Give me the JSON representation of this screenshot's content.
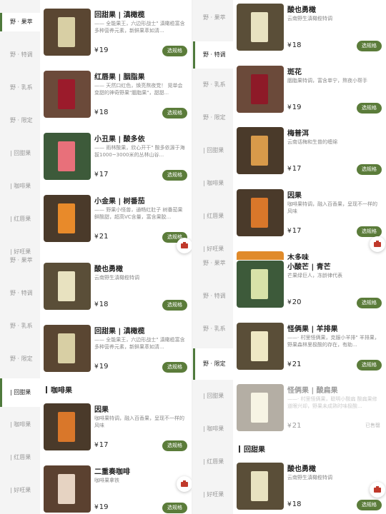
{
  "colors": {
    "accent": "#5b7c3a",
    "active_bar": "#4f7a3c",
    "price": "#222222",
    "sidebar_bg": "#f4f4f4"
  },
  "currency": "¥",
  "left_screen": {
    "sidebar": [
      {
        "label": "野 · 果萃",
        "active": true
      },
      {
        "label": "野 · 特调",
        "active": false
      },
      {
        "label": "野 · 乳系",
        "active": false
      },
      {
        "label": "野 · 限定",
        "active": false
      },
      {
        "label": "| 回甜果",
        "active": false
      },
      {
        "label": "| 咖啡果",
        "active": false
      },
      {
        "label": "| 红唇果",
        "active": false
      },
      {
        "label": "| 好旺果",
        "active": false
      },
      {
        "label": "野 · 果萃",
        "active": false
      },
      {
        "label": "野 · 特调",
        "active": false
      },
      {
        "label": "野 · 乳系",
        "active": false
      },
      {
        "label": "野 · 限定",
        "active": false
      },
      {
        "label": "| 回甜果",
        "active": true
      },
      {
        "label": "| 咖啡果",
        "active": false
      },
      {
        "label": "| 红唇果",
        "active": false
      },
      {
        "label": "| 好旺果",
        "active": false
      }
    ],
    "products": [
      {
        "name": "回甜果 | 滇橄榄",
        "desc": "—— 全能果王，六边形战士\" 滇橄榄富含多种营养元素，新鲜果萃如清...",
        "price": "19",
        "button": "选规格",
        "thumb": "olive"
      },
      {
        "name": "红唇果 | 胭脂果",
        "desc": "—— 天然口红色，焕亮熬夜党！ 晃单会变甜的神奇野果\"胭脂果\"，甜甜...",
        "price": "18",
        "button": "选规格",
        "thumb": "red"
      },
      {
        "name": "小丑果 | 酸多依",
        "desc": "—— 雨林酸果，欣心开干\" 酸多依源于海拔1000~3000米的丛林山谷...",
        "price": "17",
        "button": "选规格",
        "thumb": "pink"
      },
      {
        "name": "小金果 | 树番茄",
        "desc": "—— 野果小怪兽，通畅红肚子 树番茄果鲜酸甜，超高VC含量，富含果胶...",
        "price": "21",
        "button": "选规格",
        "thumb": "orange"
      },
      {
        "name": "酸也勇橄",
        "desc": "云南野生滇橄榄特调",
        "price": "18",
        "button": "选规格",
        "thumb": "cream"
      },
      {
        "name": "回甜果 | 滇橄榄",
        "desc": "—— 全能果王，六边形战士\" 滇橄榄富含多种营养元素，新鲜果萃如清...",
        "price": "19",
        "button": "选规格",
        "thumb": "olive"
      },
      {
        "name": "因果",
        "desc": "咖啡果特调，融入百香果，呈现不一样的风味",
        "price": "17",
        "button": "选规格",
        "thumb": "amber"
      },
      {
        "name": "二重奏咖啡",
        "desc": "咖啡果拿铁",
        "price": "19",
        "button": "选规格",
        "thumb": "latte"
      }
    ],
    "section": "咖啡果"
  },
  "right_screen": {
    "sidebar": [
      {
        "label": "野 · 果萃",
        "active": false
      },
      {
        "label": "野 · 特调",
        "active": true
      },
      {
        "label": "野 · 乳系",
        "active": false
      },
      {
        "label": "野 · 限定",
        "active": false
      },
      {
        "label": "| 回甜果",
        "active": false
      },
      {
        "label": "| 咖啡果",
        "active": false
      },
      {
        "label": "| 红唇果",
        "active": false
      },
      {
        "label": "| 好旺果",
        "active": false
      },
      {
        "label": "野 · 果萃",
        "active": false
      },
      {
        "label": "野 · 特调",
        "active": false
      },
      {
        "label": "野 · 乳系",
        "active": false
      },
      {
        "label": "野 · 限定",
        "active": true
      },
      {
        "label": "| 回甜果",
        "active": false
      },
      {
        "label": "| 咖啡果",
        "active": false
      },
      {
        "label": "| 红唇果",
        "active": false
      },
      {
        "label": "| 好旺果",
        "active": false
      }
    ],
    "products": [
      {
        "name": "酸也勇橄",
        "desc": "云南野生滇橄榄特调",
        "price": "18",
        "button": "选规格",
        "thumb": "cream"
      },
      {
        "name": "斑花",
        "desc": "胭脂果特调，富含单宁，熬夜小帮手",
        "price": "19",
        "button": "选规格",
        "thumb": "red"
      },
      {
        "name": "梅普洱",
        "desc": "云南话梅和生普的缠绵",
        "price": "17",
        "button": "选规格",
        "thumb": "tea"
      },
      {
        "name": "因果",
        "desc": "咖啡果特调，融入百香果，呈现不一样的风味",
        "price": "17",
        "button": "选规格",
        "thumb": "amber"
      },
      {
        "name": "木多味",
        "desc": "",
        "price": "",
        "button": "",
        "thumb": "orange"
      },
      {
        "name": "小酸芒 | 青芒",
        "desc": "芒果绿巨人，冻龄律代表",
        "price": "20",
        "button": "选规格",
        "thumb": "mango"
      },
      {
        "name": "怪俩果 | 羊排果",
        "desc": "——· 村里怪俩果，克服小羊排\" 羊排果，野果森林里极酸的存在，有助...",
        "price": "21",
        "button": "选规格",
        "thumb": "cream"
      },
      {
        "name": "怪俩果 | 酸扁果",
        "desc": "——· 村里怪俩果，聪明小酸扁 酸扁果修道眼兴却，野果未成熟时味极酸...",
        "price": "21",
        "button": "已售罄",
        "thumb": "cream"
      },
      {
        "name": "酸也勇橄",
        "desc": "云南野生滇橄榄特调",
        "price": "18",
        "button": "选规格",
        "thumb": "cream"
      }
    ],
    "section": "回甜果"
  }
}
